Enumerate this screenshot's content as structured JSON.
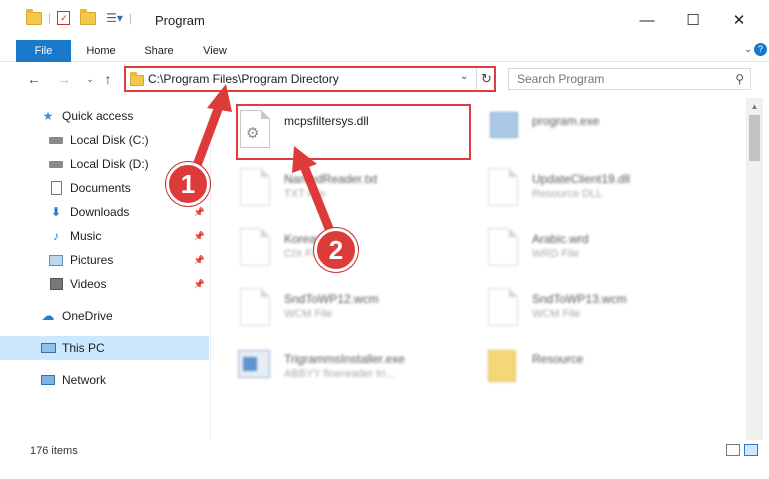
{
  "window": {
    "title": "Program",
    "minimize": "—",
    "maximize": "☐",
    "close": "✕"
  },
  "ribbon": {
    "tabs": [
      "File",
      "Home",
      "Share",
      "View"
    ]
  },
  "address": {
    "path": "C:\\Program Files\\Program Directory",
    "search_placeholder": "Search Program"
  },
  "nav": {
    "items": [
      {
        "label": "Quick access",
        "icon": "star-icon"
      },
      {
        "label": "Local Disk (C:)",
        "icon": "drive-icon"
      },
      {
        "label": "Local Disk (D:)",
        "icon": "drive-icon"
      },
      {
        "label": "Documents",
        "icon": "documents-icon"
      },
      {
        "label": "Downloads",
        "icon": "download-icon"
      },
      {
        "label": "Music",
        "icon": "music-icon"
      },
      {
        "label": "Pictures",
        "icon": "pictures-icon"
      },
      {
        "label": "Videos",
        "icon": "videos-icon"
      },
      {
        "label": "OneDrive",
        "icon": "cloud-icon"
      },
      {
        "label": "This PC",
        "icon": "computer-icon"
      },
      {
        "label": "Network",
        "icon": "network-icon"
      }
    ]
  },
  "files": [
    {
      "name": "mcpsfiltersys.dll",
      "type": ""
    },
    {
      "name": "program.exe",
      "type": ""
    },
    {
      "name": "NamedReader.txt",
      "type": "TXT File"
    },
    {
      "name": "UpdateClient19.dll",
      "type": "Resource DLL"
    },
    {
      "name": "Korean.cdx",
      "type": "CIX File"
    },
    {
      "name": "Arabic.wrd",
      "type": "WRD File"
    },
    {
      "name": "SndToWP12.wcm",
      "type": "WCM File"
    },
    {
      "name": "SndToWP13.wcm",
      "type": "WCM File"
    },
    {
      "name": "TrigrammsInstaller.exe",
      "type": "ABBYY finereader tri..."
    },
    {
      "name": "Resource",
      "type": ""
    }
  ],
  "status": {
    "item_count": "176 items"
  },
  "annotations": {
    "badge1": "1",
    "badge2": "2"
  },
  "colors": {
    "highlight": "#e23d3d",
    "file_tab": "#1979ca",
    "selected_nav": "#cce8ff"
  }
}
